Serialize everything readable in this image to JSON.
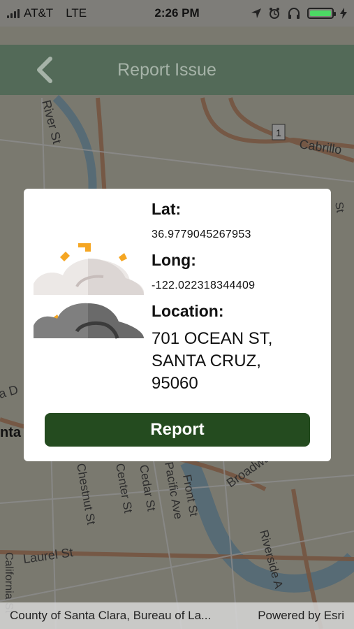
{
  "status_bar": {
    "carrier": "AT&T",
    "network": "LTE",
    "time": "2:26 PM"
  },
  "navbar": {
    "title": "Report Issue",
    "back_icon": "chevron-left-icon"
  },
  "map_labels": {
    "river_st": "River St",
    "cabrillo": "Cabrillo",
    "route_shield": "1",
    "st_fragment": "St",
    "ta_fragment": "a D",
    "anta_fragment": "nta",
    "broadway": "Broadway",
    "front_st": "Front St",
    "pacific_ave": "Pacific Ave",
    "cedar_st": "Cedar St",
    "center_st": "Center St",
    "chestnut_st": "Chestnut St",
    "laurel_st": "Laurel St",
    "riverside": "Riverside A",
    "california": "California St"
  },
  "dialog": {
    "lat_label": "Lat:",
    "lat_value": "36.9779045267953",
    "long_label": "Long:",
    "long_value": "-122.022318344409",
    "location_label": "Location:",
    "address_line1": "701 OCEAN ST,",
    "address_line2": "SANTA CRUZ,",
    "address_line3": "95060",
    "report_button": "Report",
    "weather_icon": "partly-cloudy-sun-icon"
  },
  "attribution": {
    "source": "County of Santa Clara, Bureau of La...",
    "powered_by": "Powered by Esri"
  },
  "colors": {
    "navbar": "#536a58",
    "report_button": "#244b1f",
    "battery": "#4cd964",
    "sun": "#f5a623"
  }
}
